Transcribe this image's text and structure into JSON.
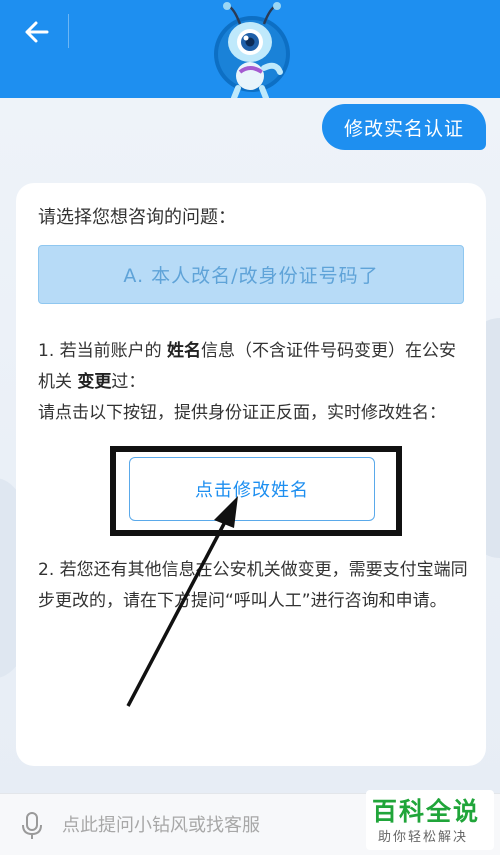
{
  "user_message": "修改实名认证",
  "reply": {
    "prompt": "请选择您想咨询的问题：",
    "option_a": "A. 本人改名/改身份证号码了",
    "p1_before": "1. 若当前账户的 ",
    "p1_bold1": "姓名",
    "p1_mid": "信息（不含证件号码变更）在公安机关 ",
    "p1_bold2": "变更",
    "p1_after": "过：",
    "p1_line2": " 请点击以下按钮，提供身份证正反面，实时修改姓名：",
    "modify_button": "点击修改姓名",
    "p2": "2. 若您还有其他信息在公安机关做变更，需要支付宝端同步更改的，请在下方提问“呼叫人工”进行咨询和申请。"
  },
  "input": {
    "placeholder": "点此提问小钻风或找客服"
  },
  "watermark": {
    "title": "百科全说",
    "subtitle": "助你轻松解决"
  },
  "colors": {
    "primary": "#1e8ff0",
    "option_bg": "#b7dbf7",
    "watermark_green": "#20a53a"
  }
}
